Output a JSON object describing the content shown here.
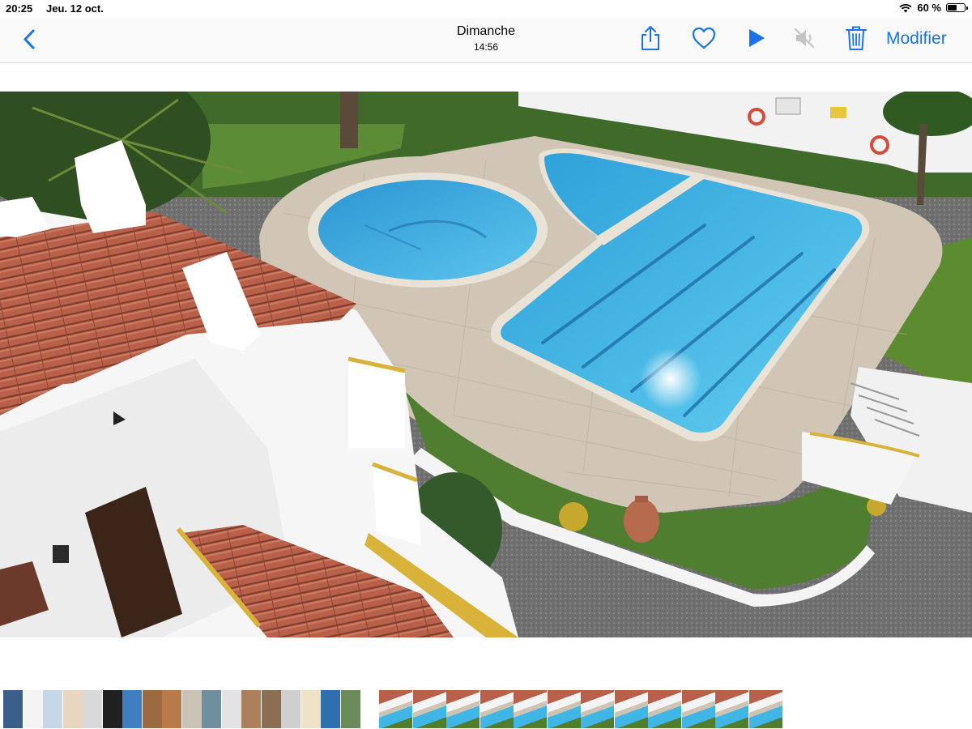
{
  "status_bar": {
    "time": "20:25",
    "date": "Jeu. 12 oct.",
    "battery_text": "60 %",
    "battery_level": 0.6,
    "icons": [
      "wifi-icon",
      "battery-icon"
    ]
  },
  "nav": {
    "back_icon": "chevron-left-icon",
    "title": "Dimanche",
    "subtitle": "14:56",
    "tools": [
      "share-icon",
      "heart-icon",
      "play-icon",
      "mute-icon",
      "trash-icon"
    ],
    "edit_label": "Modifier",
    "accent_color": "#1a73e8"
  },
  "photo": {
    "subject": "aerial view of swimming pool and white villas",
    "colors": {
      "pool": "#3fb6e6",
      "deck": "#cfc4b4",
      "lawn": "#4f7e30",
      "roof": "#b85f4b",
      "wall": "#f6f6f6"
    }
  },
  "filmstrip": {
    "group_a_count": 18,
    "group_b_count": 12
  }
}
